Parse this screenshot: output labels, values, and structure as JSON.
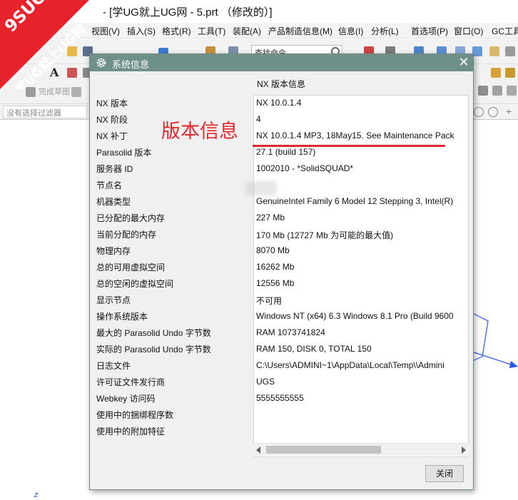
{
  "window": {
    "title": "- [学UG就上UG网 - 5.prt （修改的）]"
  },
  "watermark": {
    "line1": "9SUG",
    "line2": "学UG就上UG网",
    "color": "#e8222b"
  },
  "menu": {
    "items": [
      "视图(V)",
      "插入(S)",
      "格式(R)",
      "工具(T)",
      "装配(A)",
      "产品制造信息(M)",
      "信息(I)",
      "分析(L)",
      "首选项(P)",
      "窗口(O)",
      "GC工具"
    ]
  },
  "toolbar": {
    "search_value": "查找命令",
    "finish_sketch_label": "完成草图",
    "filter_placeholder": "没有选择过滤器",
    "text_tool_glyph": "A"
  },
  "viewport": {
    "corner_label": "z"
  },
  "dialog": {
    "title": "系统信息",
    "close_glyph": "✕",
    "panel_header": "NX 版本信息",
    "annotation": "版本信息",
    "annotation_color": "#e0292f",
    "close_button_label": "关闭",
    "rows": [
      {
        "label": "NX 版本",
        "value": "NX 10.0.1.4"
      },
      {
        "label": "NX 阶段",
        "value": "4"
      },
      {
        "label": "NX 补丁",
        "value": "NX 10.0.1.4 MP3, 18May15.  See Maintenance Pack"
      },
      {
        "label": "Parasolid 版本",
        "value": "27.1 (build 157)"
      },
      {
        "label": "服务器 ID",
        "value": "1002010 - *SolidSQUAD*"
      },
      {
        "label": "节点名",
        "value": ""
      },
      {
        "label": "机器类型",
        "value": "GenuineIntel Family 6 Model 12 Stepping 3, Intel(R)"
      },
      {
        "label": "已分配的最大内存",
        "value": "227 Mb"
      },
      {
        "label": "当前分配的内存",
        "value": "170 Mb (12727 Mb 为可能的最大值)"
      },
      {
        "label": "物理内存",
        "value": "8070 Mb"
      },
      {
        "label": "总的可用虚拟空间",
        "value": "16262 Mb"
      },
      {
        "label": "总的空闲的虚拟空间",
        "value": "12556 Mb"
      },
      {
        "label": "显示节点",
        "value": "不可用"
      },
      {
        "label": "操作系统版本",
        "value": "Windows NT (x64) 6.3 Windows 8.1 Pro (Build 9600"
      },
      {
        "label": "最大的 Parasolid Undo 字节数",
        "value": "RAM 1073741824"
      },
      {
        "label": "实际的 Parasolid Undo 字节数",
        "value": "RAM 150, DISK 0, TOTAL 150"
      },
      {
        "label": "日志文件",
        "value": "C:\\Users\\ADMINI~1\\AppData\\Local\\Temp\\\\Admini"
      },
      {
        "label": "许可证文件发行商",
        "value": "UGS"
      },
      {
        "label": "Webkey 访问码",
        "value": "5555555555"
      },
      {
        "label": "使用中的捆绑程序数",
        "value": ""
      },
      {
        "label": "使用中的附加特征",
        "value": ""
      }
    ]
  }
}
